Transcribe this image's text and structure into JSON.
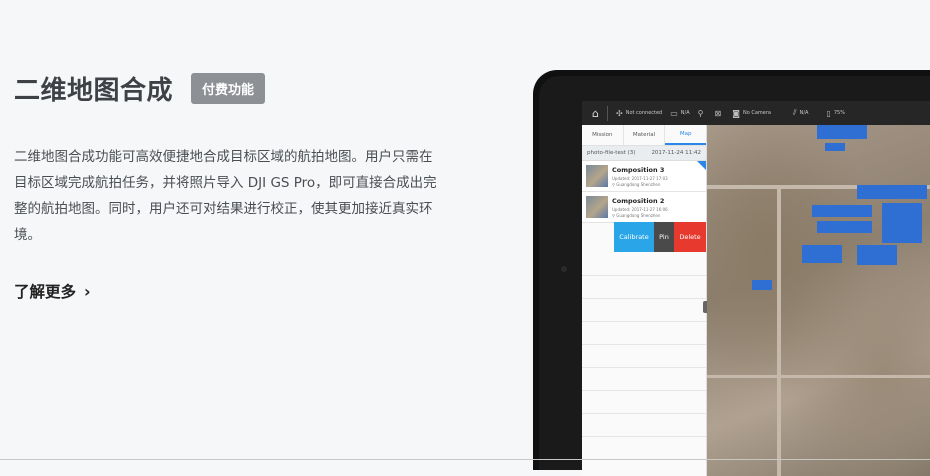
{
  "section": {
    "title": "二维地图合成",
    "badge": "付费功能",
    "description": "二维地图合成功能可高效便捷地合成目标区域的航拍地图。用户只需在目标区域完成航拍任务，并将照片导入 DJI GS Pro，即可直接合成出完整的航拍地图。同时，用户还可对结果进行校正，使其更加接近真实环境。",
    "learn_more": "了解更多",
    "chevron": "›"
  },
  "app": {
    "topbar": {
      "home_icon": "⌂",
      "aircraft_status": "Not connected",
      "n_a_1": "N/A",
      "no_camera": "No Camera",
      "n_a_2": "N/A",
      "percent": "75%"
    },
    "tabs": [
      "Mission",
      "Material",
      "Map"
    ],
    "folder": {
      "name": "photo-file-test (3)",
      "date": "2017-11-24 11:42"
    },
    "items": [
      {
        "title": "Composition 3",
        "updated": "Updated: 2017-11-27 17:03",
        "location": "Guangdong Shenzhen"
      },
      {
        "title": "Composition 2",
        "updated": "Updated: 2017-11-27 16:06",
        "location": "Guangdong Shenzhen"
      }
    ],
    "actions": {
      "calibrate": "Calibrate",
      "pin": "Pin",
      "delete": "Delete"
    }
  },
  "colors": {
    "accent": "#2a89e8",
    "delete": "#e8392f",
    "calibrate": "#2aa6e8",
    "badge": "#8d9196"
  }
}
